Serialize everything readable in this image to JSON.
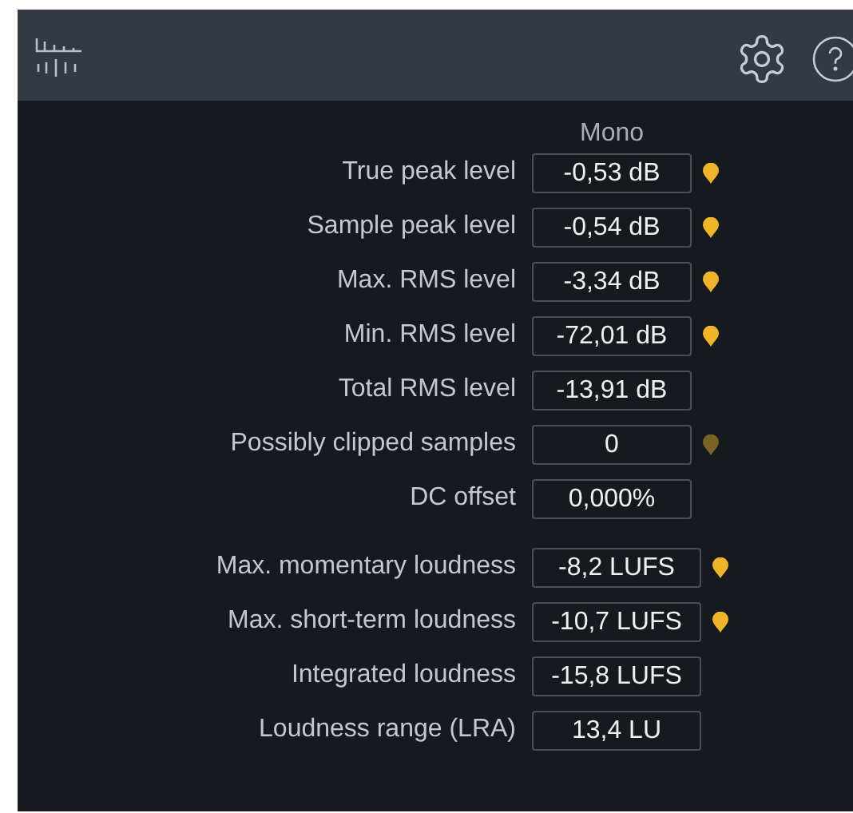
{
  "channel_header": "Mono",
  "groups": [
    {
      "rows": [
        {
          "label": "True peak level",
          "value": "-0,53 dB",
          "kind": "lit"
        },
        {
          "label": "Sample peak level",
          "value": "-0,54 dB",
          "kind": "lit"
        },
        {
          "label": "Max. RMS level",
          "value": "-3,34 dB",
          "kind": "lit"
        },
        {
          "label": "Min. RMS level",
          "value": "-72,01 dB",
          "kind": "lit"
        },
        {
          "label": "Total RMS level",
          "value": "-13,91 dB",
          "kind": "plain"
        },
        {
          "label": "Possibly clipped samples",
          "value": "0",
          "kind": "dim"
        },
        {
          "label": "DC offset",
          "value": "0,000%",
          "kind": "plain"
        }
      ]
    },
    {
      "rows": [
        {
          "label": "Max. momentary loudness",
          "value": "-8,2 LUFS",
          "kind": "lit"
        },
        {
          "label": "Max. short-term loudness",
          "value": "-10,7 LUFS",
          "kind": "lit"
        },
        {
          "label": "Integrated loudness",
          "value": "-15,8 LUFS",
          "kind": "plain"
        },
        {
          "label": "Loudness range (LRA)",
          "value": "13,4 LU",
          "kind": "plain"
        }
      ]
    }
  ]
}
